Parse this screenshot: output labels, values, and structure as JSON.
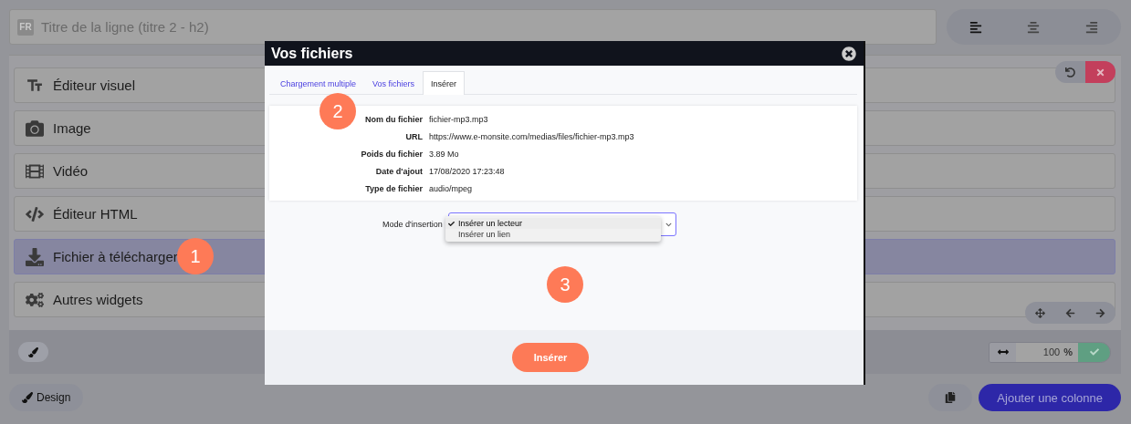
{
  "title_field": {
    "lang_badge": "FR",
    "placeholder": "Titre de la ligne (titre 2 - h2)"
  },
  "alignment": [
    {
      "kind": "left",
      "selected": true
    },
    {
      "kind": "center",
      "selected": false
    },
    {
      "kind": "right",
      "selected": false
    }
  ],
  "widgets": [
    {
      "kind": "text",
      "label": "Éditeur visuel",
      "selected": false
    },
    {
      "kind": "image",
      "label": "Image",
      "selected": false
    },
    {
      "kind": "video",
      "label": "Vidéo",
      "selected": false
    },
    {
      "kind": "html",
      "label": "Éditeur HTML",
      "selected": false
    },
    {
      "kind": "download",
      "label": "Fichier à télécharger",
      "selected": true
    },
    {
      "kind": "other",
      "label": "Autres widgets",
      "selected": false
    }
  ],
  "width_control": {
    "value": "100",
    "unit": "%"
  },
  "design_button": "Design",
  "add_column_button": "Ajouter une colonne",
  "modal": {
    "title": "Vos fichiers",
    "tabs": [
      {
        "label": "Chargement multiple",
        "selected": false
      },
      {
        "label": "Vos fichiers",
        "selected": false
      },
      {
        "label": "Insérer",
        "selected": true
      }
    ],
    "file_info": [
      {
        "label": "Nom du fichier",
        "value": "fichier-mp3.mp3"
      },
      {
        "label": "URL",
        "value": "https://www.e-monsite.com/medias/files/fichier-mp3.mp3"
      },
      {
        "label": "Poids du fichier",
        "value": "3.89 Mo"
      },
      {
        "label": "Date d'ajout",
        "value": "17/08/2020 17:23:48"
      },
      {
        "label": "Type de fichier",
        "value": "audio/mpeg"
      }
    ],
    "insert_mode": {
      "label": "Mode d'insertion",
      "options": [
        {
          "label": "Insérer un lecteur",
          "selected": true
        },
        {
          "label": "Insérer un lien",
          "selected": false
        }
      ]
    },
    "submit": "Insérer"
  },
  "step_markers": [
    "1",
    "2",
    "3"
  ]
}
